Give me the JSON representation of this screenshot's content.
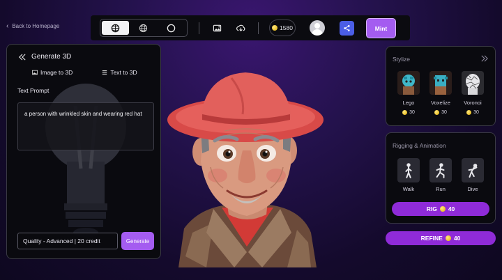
{
  "nav": {
    "back_label": "Back to Homepage"
  },
  "toolbar": {
    "view_modes": [
      "textured-view",
      "wireframe-view",
      "solid-view"
    ],
    "active_view_mode": "textured-view",
    "coins": "1580",
    "mint_label": "Mint"
  },
  "generate_panel": {
    "title": "Generate 3D",
    "tabs": [
      {
        "label": "Image to 3D",
        "icon": "image-icon"
      },
      {
        "label": "Text to 3D",
        "icon": "list-icon"
      }
    ],
    "prompt_label": "Text Prompt",
    "prompt_value": "a person with wrinkled skin and wearing red hat",
    "quality_value": "Quality - Advanced | 20 credit",
    "generate_label": "Generate"
  },
  "stylize_panel": {
    "title": "Stylize",
    "items": [
      {
        "name": "Lego",
        "price": "30"
      },
      {
        "name": "Voxelize",
        "price": "30"
      },
      {
        "name": "Voronoi",
        "price": "30"
      }
    ]
  },
  "rigging_panel": {
    "title": "Rigging & Animation",
    "animations": [
      {
        "name": "Walk"
      },
      {
        "name": "Run"
      },
      {
        "name": "Dive"
      }
    ],
    "rig_label": "RIG",
    "rig_price": "40"
  },
  "refine": {
    "label": "REFINE",
    "price": "40"
  },
  "colors": {
    "accent": "#a45cf0",
    "button_purple": "#8f2bd8",
    "share_blue": "#4b5ee6"
  }
}
